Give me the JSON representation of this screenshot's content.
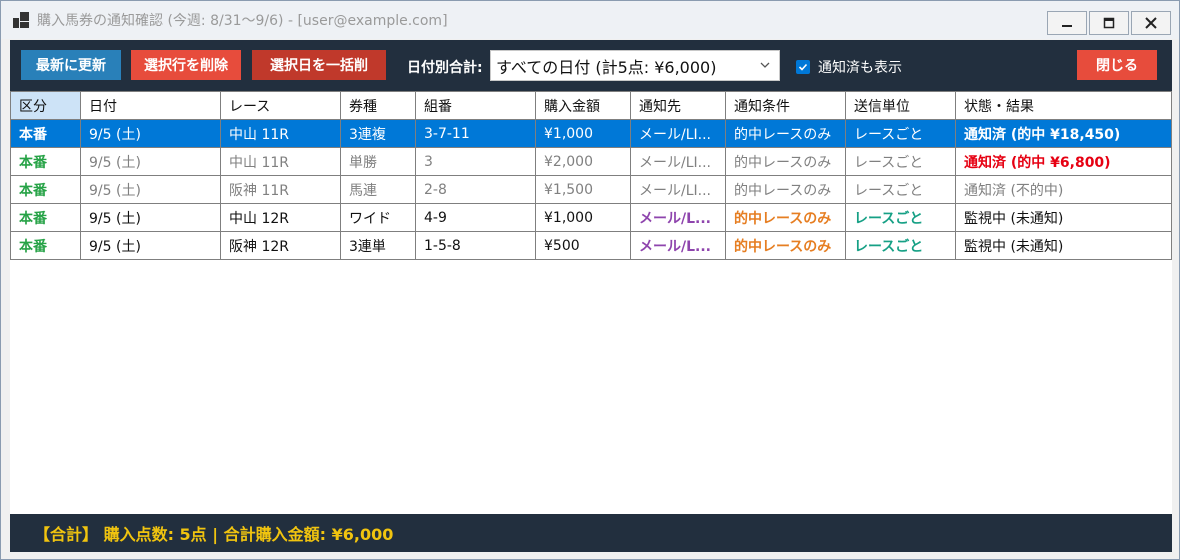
{
  "window": {
    "title": "購入馬券の通知確認 (今週: 8/31〜9/6) - [user@example.com]"
  },
  "toolbar": {
    "refresh_label": "最新に更新",
    "delete_row_label": "選択行を削除",
    "delete_day_label": "選択日を一括削",
    "date_total_label": "日付別合計:",
    "date_combo_value": "すべての日付 (計5点: ¥6,000)",
    "show_notified_label": "通知済も表示",
    "close_label": "閉じる"
  },
  "colors": {
    "refresh_btn": "#2980b9",
    "delete_row_btn": "#e74c3c",
    "delete_day_btn": "#c0392b",
    "close_btn": "#e74c3c",
    "toolbar_bg": "#222f3e",
    "selection": "#0078d7"
  },
  "table": {
    "headers": [
      "区分",
      "日付",
      "レース",
      "券種",
      "組番",
      "購入金額",
      "通知先",
      "通知条件",
      "送信単位",
      "状態・結果"
    ],
    "rows": [
      [
        "本番",
        "9/5 (土)",
        "中山 11R",
        "3連複",
        "3-7-11",
        "¥1,000",
        "メール/LI...",
        "的中レースのみ",
        "レースごと",
        "通知済 (的中 ¥18,450)"
      ],
      [
        "本番",
        "9/5 (土)",
        "中山 11R",
        "単勝",
        "3",
        "¥2,000",
        "メール/LI...",
        "的中レースのみ",
        "レースごと",
        "通知済 (的中 ¥6,800)"
      ],
      [
        "本番",
        "9/5 (土)",
        "阪神 11R",
        "馬連",
        "2-8",
        "¥1,500",
        "メール/LI...",
        "的中レースのみ",
        "レースごと",
        "通知済 (不的中)"
      ],
      [
        "本番",
        "9/5 (土)",
        "中山 12R",
        "ワイド",
        "4-9",
        "¥1,000",
        "メール/L...",
        "的中レースのみ",
        "レースごと",
        "監視中 (未通知)"
      ],
      [
        "本番",
        "9/5 (土)",
        "阪神 12R",
        "3連単",
        "1-5-8",
        "¥500",
        "メール/L...",
        "的中レースのみ",
        "レースごと",
        "監視中 (未通知)"
      ]
    ]
  },
  "status_bar": {
    "summary": "【合計】 購入点数: 5点 | 合計購入金額: ¥6,000"
  }
}
